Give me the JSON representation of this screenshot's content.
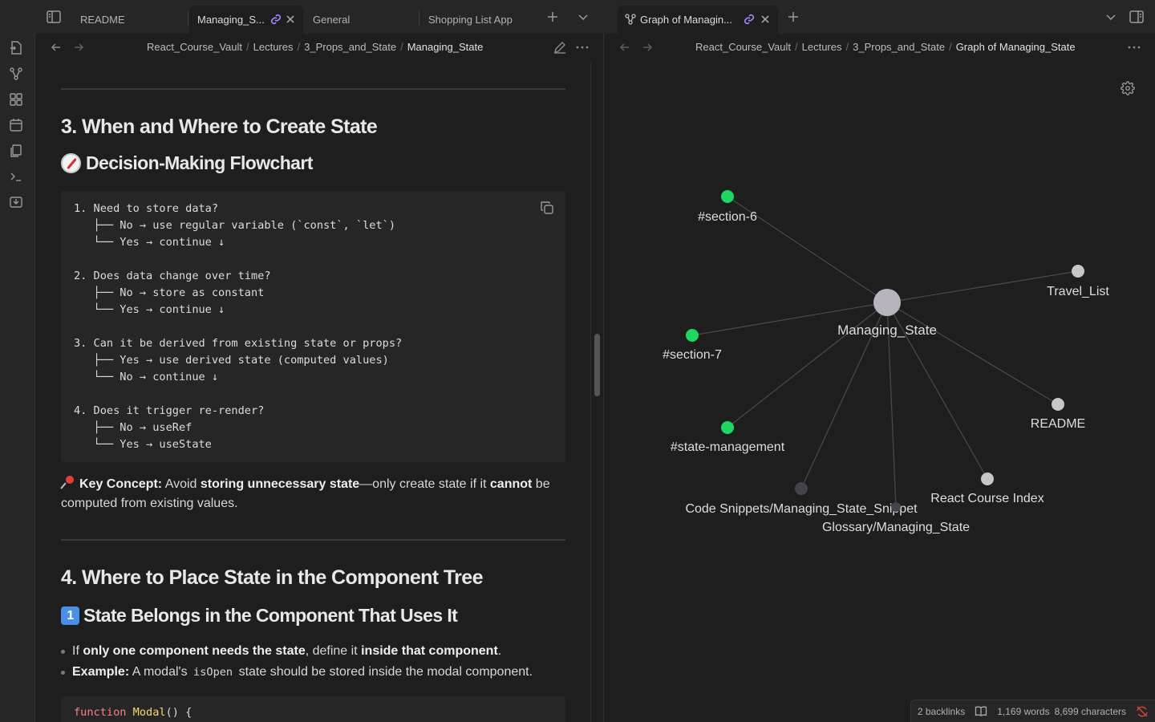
{
  "tabs": {
    "items": [
      {
        "label": "README"
      },
      {
        "label": "Managing_S..."
      },
      {
        "label": "General"
      },
      {
        "label": "Shopping List App"
      },
      {
        "label": "Graph of Managin..."
      }
    ]
  },
  "left_pane": {
    "breadcrumb": [
      "React_Course_Vault",
      "Lectures",
      "3_Props_and_State",
      "Managing_State"
    ],
    "h_section3": "3. When and Where to Create State",
    "h_flowchart": "Decision-Making Flowchart",
    "flowchart_code": "1. Need to store data?\n   ├── No → use regular variable (`const`, `let`)\n   └── Yes → continue ↓\n\n2. Does data change over time?\n   ├── No → store as constant\n   └── Yes → continue ↓\n\n3. Can it be derived from existing state or props?\n   ├── Yes → use derived state (computed values)\n   └── No → continue ↓\n\n4. Does it trigger re-render?\n   ├── No → useRef\n   └── Yes → useState",
    "key_concept": {
      "label": "Key Concept:",
      "t1": " Avoid ",
      "b1": "storing unnecessary state",
      "t2": "—only create state if it ",
      "b2": "cannot",
      "t3": " be computed from existing values."
    },
    "h_section4": "4. Where to Place State in the Component Tree",
    "h_state_belongs": "State Belongs in the Component That Uses It",
    "bullet1": {
      "t1": "If ",
      "b1": "only one component needs the state",
      "t2": ", define it ",
      "b2": "inside that component",
      "t3": "."
    },
    "bullet2": {
      "b1": "Example:",
      "t1": " A modal's ",
      "code": "isOpen",
      "t2": " state should be stored inside the modal component."
    },
    "code2": {
      "kw": "function",
      "fn": "Modal",
      "rest": "() {"
    }
  },
  "right_pane": {
    "breadcrumb": [
      "React_Course_Vault",
      "Lectures",
      "3_Props_and_State",
      "Graph of Managing_State"
    ],
    "graph": {
      "center": "Managing_State",
      "nodes": [
        {
          "label": "#section-6"
        },
        {
          "label": "Travel_List"
        },
        {
          "label": "#section-7"
        },
        {
          "label": "README"
        },
        {
          "label": "#state-management"
        },
        {
          "label": "React Course Index"
        },
        {
          "label": "Code Snippets/Managing_State_Snippet"
        },
        {
          "label": "Glossary/Managing_State"
        }
      ]
    }
  },
  "status": {
    "backlinks": "2 backlinks",
    "words": "1,169 words",
    "chars": "8,699 characters"
  }
}
